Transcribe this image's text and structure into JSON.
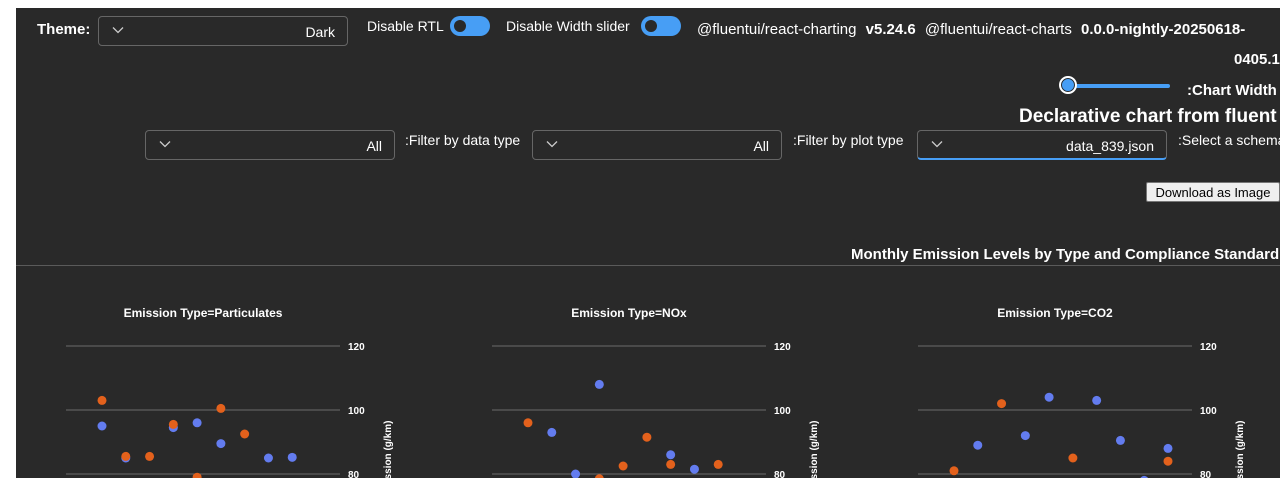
{
  "theme": {
    "label": "Theme:",
    "value": "Dark"
  },
  "toggles": {
    "rtl_label": "Disable RTL",
    "width_slider_label": "Disable Width slider"
  },
  "versions": {
    "charting_name": "@fluentui/react-charting",
    "charting_version": "v5.24.6",
    "charts_name": "@fluentui/react-charts",
    "charts_version_line1": "0.0.0-nightly-20250618-",
    "charts_version_line2": "0405.1"
  },
  "chart_width_label": ":Chart Width",
  "page_title": "Declarative chart from fluent",
  "filters": {
    "data_type_value": "All",
    "data_type_label": ":Filter by data type",
    "plot_type_value": "All",
    "plot_type_label": ":Filter by plot type",
    "schema_value": "data_839.json",
    "schema_label": ":Select a schema"
  },
  "download_button": "Download as Image",
  "colors": {
    "accent": "#479ef5",
    "series_blue": "#637cef",
    "series_orange": "#e3611c",
    "background": "#292929"
  },
  "chart_data": {
    "type": "scatter",
    "title": "Monthly Emission Levels by Type and Compliance Standard",
    "ylabel": "ssion (g/km)",
    "ylim": [
      80,
      120
    ],
    "yticks": [
      120,
      100,
      80
    ],
    "series": [
      {
        "color": "#637cef"
      },
      {
        "color": "#e3611c"
      }
    ],
    "facets": [
      {
        "title": "Emission Type=Particulates",
        "points": [
          {
            "x": 1,
            "y": 95,
            "s": 0
          },
          {
            "x": 1,
            "y": 103,
            "s": 1
          },
          {
            "x": 2,
            "y": 85,
            "s": 0
          },
          {
            "x": 2,
            "y": 85.5,
            "s": 1
          },
          {
            "x": 3,
            "y": 85.5,
            "s": 1
          },
          {
            "x": 4,
            "y": 94.5,
            "s": 0
          },
          {
            "x": 4,
            "y": 95.5,
            "s": 1
          },
          {
            "x": 5,
            "y": 96,
            "s": 0
          },
          {
            "x": 5,
            "y": 79,
            "s": 1
          },
          {
            "x": 6,
            "y": 89.5,
            "s": 0
          },
          {
            "x": 6,
            "y": 100.5,
            "s": 1
          },
          {
            "x": 7,
            "y": 92.5,
            "s": 1
          },
          {
            "x": 8,
            "y": 85,
            "s": 0
          },
          {
            "x": 9,
            "y": 85.2,
            "s": 0
          }
        ]
      },
      {
        "title": "Emission Type=NOx",
        "points": [
          {
            "x": 1,
            "y": 96,
            "s": 1
          },
          {
            "x": 2,
            "y": 93,
            "s": 0
          },
          {
            "x": 3,
            "y": 80,
            "s": 0
          },
          {
            "x": 4,
            "y": 108,
            "s": 0
          },
          {
            "x": 4,
            "y": 78.5,
            "s": 1
          },
          {
            "x": 5,
            "y": 82.5,
            "s": 1
          },
          {
            "x": 6,
            "y": 91.5,
            "s": 1
          },
          {
            "x": 7,
            "y": 86,
            "s": 0
          },
          {
            "x": 7,
            "y": 83,
            "s": 1
          },
          {
            "x": 8,
            "y": 81.5,
            "s": 0
          },
          {
            "x": 9,
            "y": 83,
            "s": 1
          }
        ]
      },
      {
        "title": "Emission Type=CO2",
        "points": [
          {
            "x": 1,
            "y": 81,
            "s": 1
          },
          {
            "x": 2,
            "y": 89,
            "s": 0
          },
          {
            "x": 3,
            "y": 102,
            "s": 1
          },
          {
            "x": 4,
            "y": 92,
            "s": 0
          },
          {
            "x": 5,
            "y": 104,
            "s": 0
          },
          {
            "x": 6,
            "y": 85,
            "s": 1
          },
          {
            "x": 7,
            "y": 103,
            "s": 0
          },
          {
            "x": 8,
            "y": 90.5,
            "s": 0
          },
          {
            "x": 9,
            "y": 78,
            "s": 0
          },
          {
            "x": 10,
            "y": 88,
            "s": 0
          },
          {
            "x": 10,
            "y": 84,
            "s": 1
          }
        ]
      }
    ]
  }
}
